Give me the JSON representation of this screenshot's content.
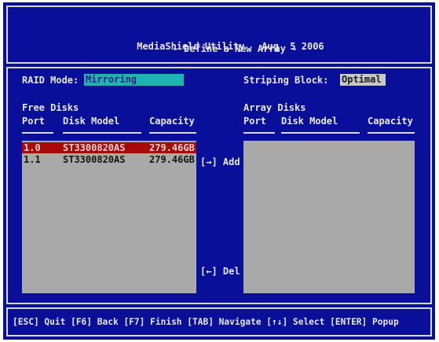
{
  "header": {
    "app_name": "MediaShield Utility",
    "date": "Aug  5 2006",
    "subtitle": "- Define a New Array -"
  },
  "raid_mode": {
    "label": "RAID Mode:",
    "value": "Mirroring"
  },
  "striping_block": {
    "label": "Striping Block:",
    "value": "Optimal"
  },
  "free_disks": {
    "title": "Free Disks",
    "columns": [
      "Port",
      "Disk Model",
      "Capacity"
    ],
    "rows": [
      {
        "port": "1.0",
        "model": "ST3300820AS",
        "capacity": "279.46GB",
        "selected": true
      },
      {
        "port": "1.1",
        "model": "ST3300820AS",
        "capacity": "279.46GB",
        "selected": false
      }
    ]
  },
  "array_disks": {
    "title": "Array Disks",
    "columns": [
      "Port",
      "Disk Model",
      "Capacity"
    ],
    "rows": []
  },
  "buttons": {
    "add": "[→] Add",
    "del": "[←] Del"
  },
  "footer": {
    "help": "[ESC] Quit [F6] Back [F7] Finish [TAB] Navigate [↑↓] Select [ENTER] Popup"
  },
  "colors": {
    "background": "#0a0f9a",
    "raid_field": "#1fb3b3",
    "list_panel": "#a9a9a9",
    "selection": "#a80a0a"
  }
}
